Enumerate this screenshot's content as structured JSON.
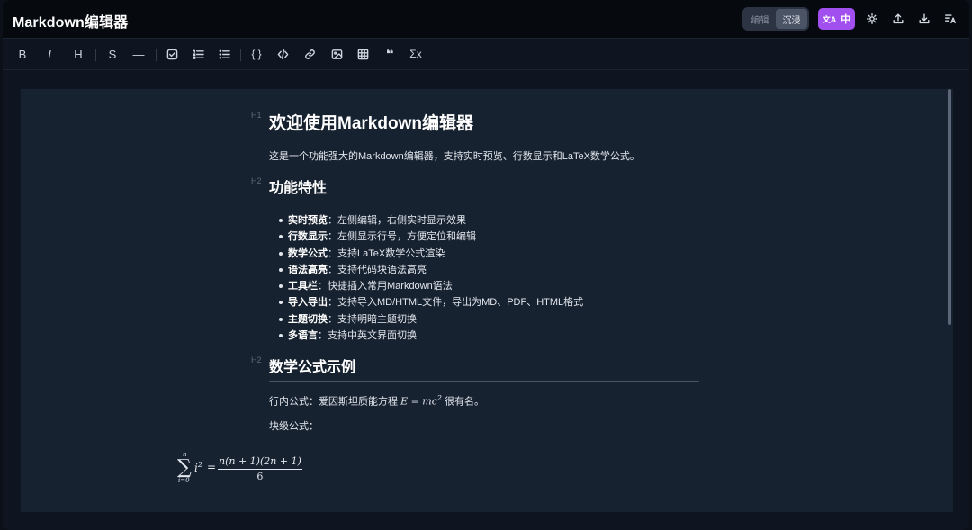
{
  "app": {
    "title": "Markdown编辑器"
  },
  "header": {
    "mode_edit": "编辑",
    "mode_immersive": "沉浸",
    "lang_label": "中",
    "lang_icon": "文A"
  },
  "toolbar": {
    "bold": "B",
    "italic": "I",
    "heading": "H",
    "strike": "S",
    "hr": "—",
    "code_block": "{ }",
    "quote": "❝",
    "formula": "Σx"
  },
  "doc": {
    "h_tags": {
      "h1": "H1",
      "h2": "H2"
    },
    "title": "欢迎使用Markdown编辑器",
    "intro": "这是一个功能强大的Markdown编辑器，支持实时预览、行数显示和LaTeX数学公式。",
    "features_heading": "功能特性",
    "features": [
      {
        "name": "实时预览",
        "desc": "：左侧编辑，右侧实时显示效果"
      },
      {
        "name": "行数显示",
        "desc": "：左侧显示行号，方便定位和编辑"
      },
      {
        "name": "数学公式",
        "desc": "：支持LaTeX数学公式渲染"
      },
      {
        "name": "语法高亮",
        "desc": "：支持代码块语法高亮"
      },
      {
        "name": "工具栏",
        "desc": "：快捷插入常用Markdown语法"
      },
      {
        "name": "导入导出",
        "desc": "：支持导入MD/HTML文件，导出为MD、PDF、HTML格式"
      },
      {
        "name": "主题切换",
        "desc": "：支持明暗主题切换"
      },
      {
        "name": "多语言",
        "desc": "：支持中英文界面切换"
      }
    ],
    "math_heading": "数学公式示例",
    "inline_prefix": "行内公式：爱因斯坦质能方程 ",
    "inline_formula": "E = mc",
    "inline_exp": "2",
    "inline_suffix": " 很有名。",
    "block_label": "块级公式：",
    "block_formula": {
      "sigma": "∑",
      "upper": "n",
      "lower": "i=0",
      "term": "i",
      "term_exp": "2",
      "equals": "=",
      "numerator": "n(n + 1)(2n + 1)",
      "denominator": "6"
    }
  },
  "icons": [
    "translate-icon",
    "sun-icon",
    "upload-icon",
    "download-icon",
    "text-direction-icon",
    "checkbox-icon",
    "ordered-list-icon",
    "unordered-list-icon",
    "code-icon",
    "link-icon",
    "image-icon",
    "table-icon"
  ],
  "colors": {
    "accent": "#a24ff0",
    "background": "#0f1520",
    "content": "#172230"
  }
}
